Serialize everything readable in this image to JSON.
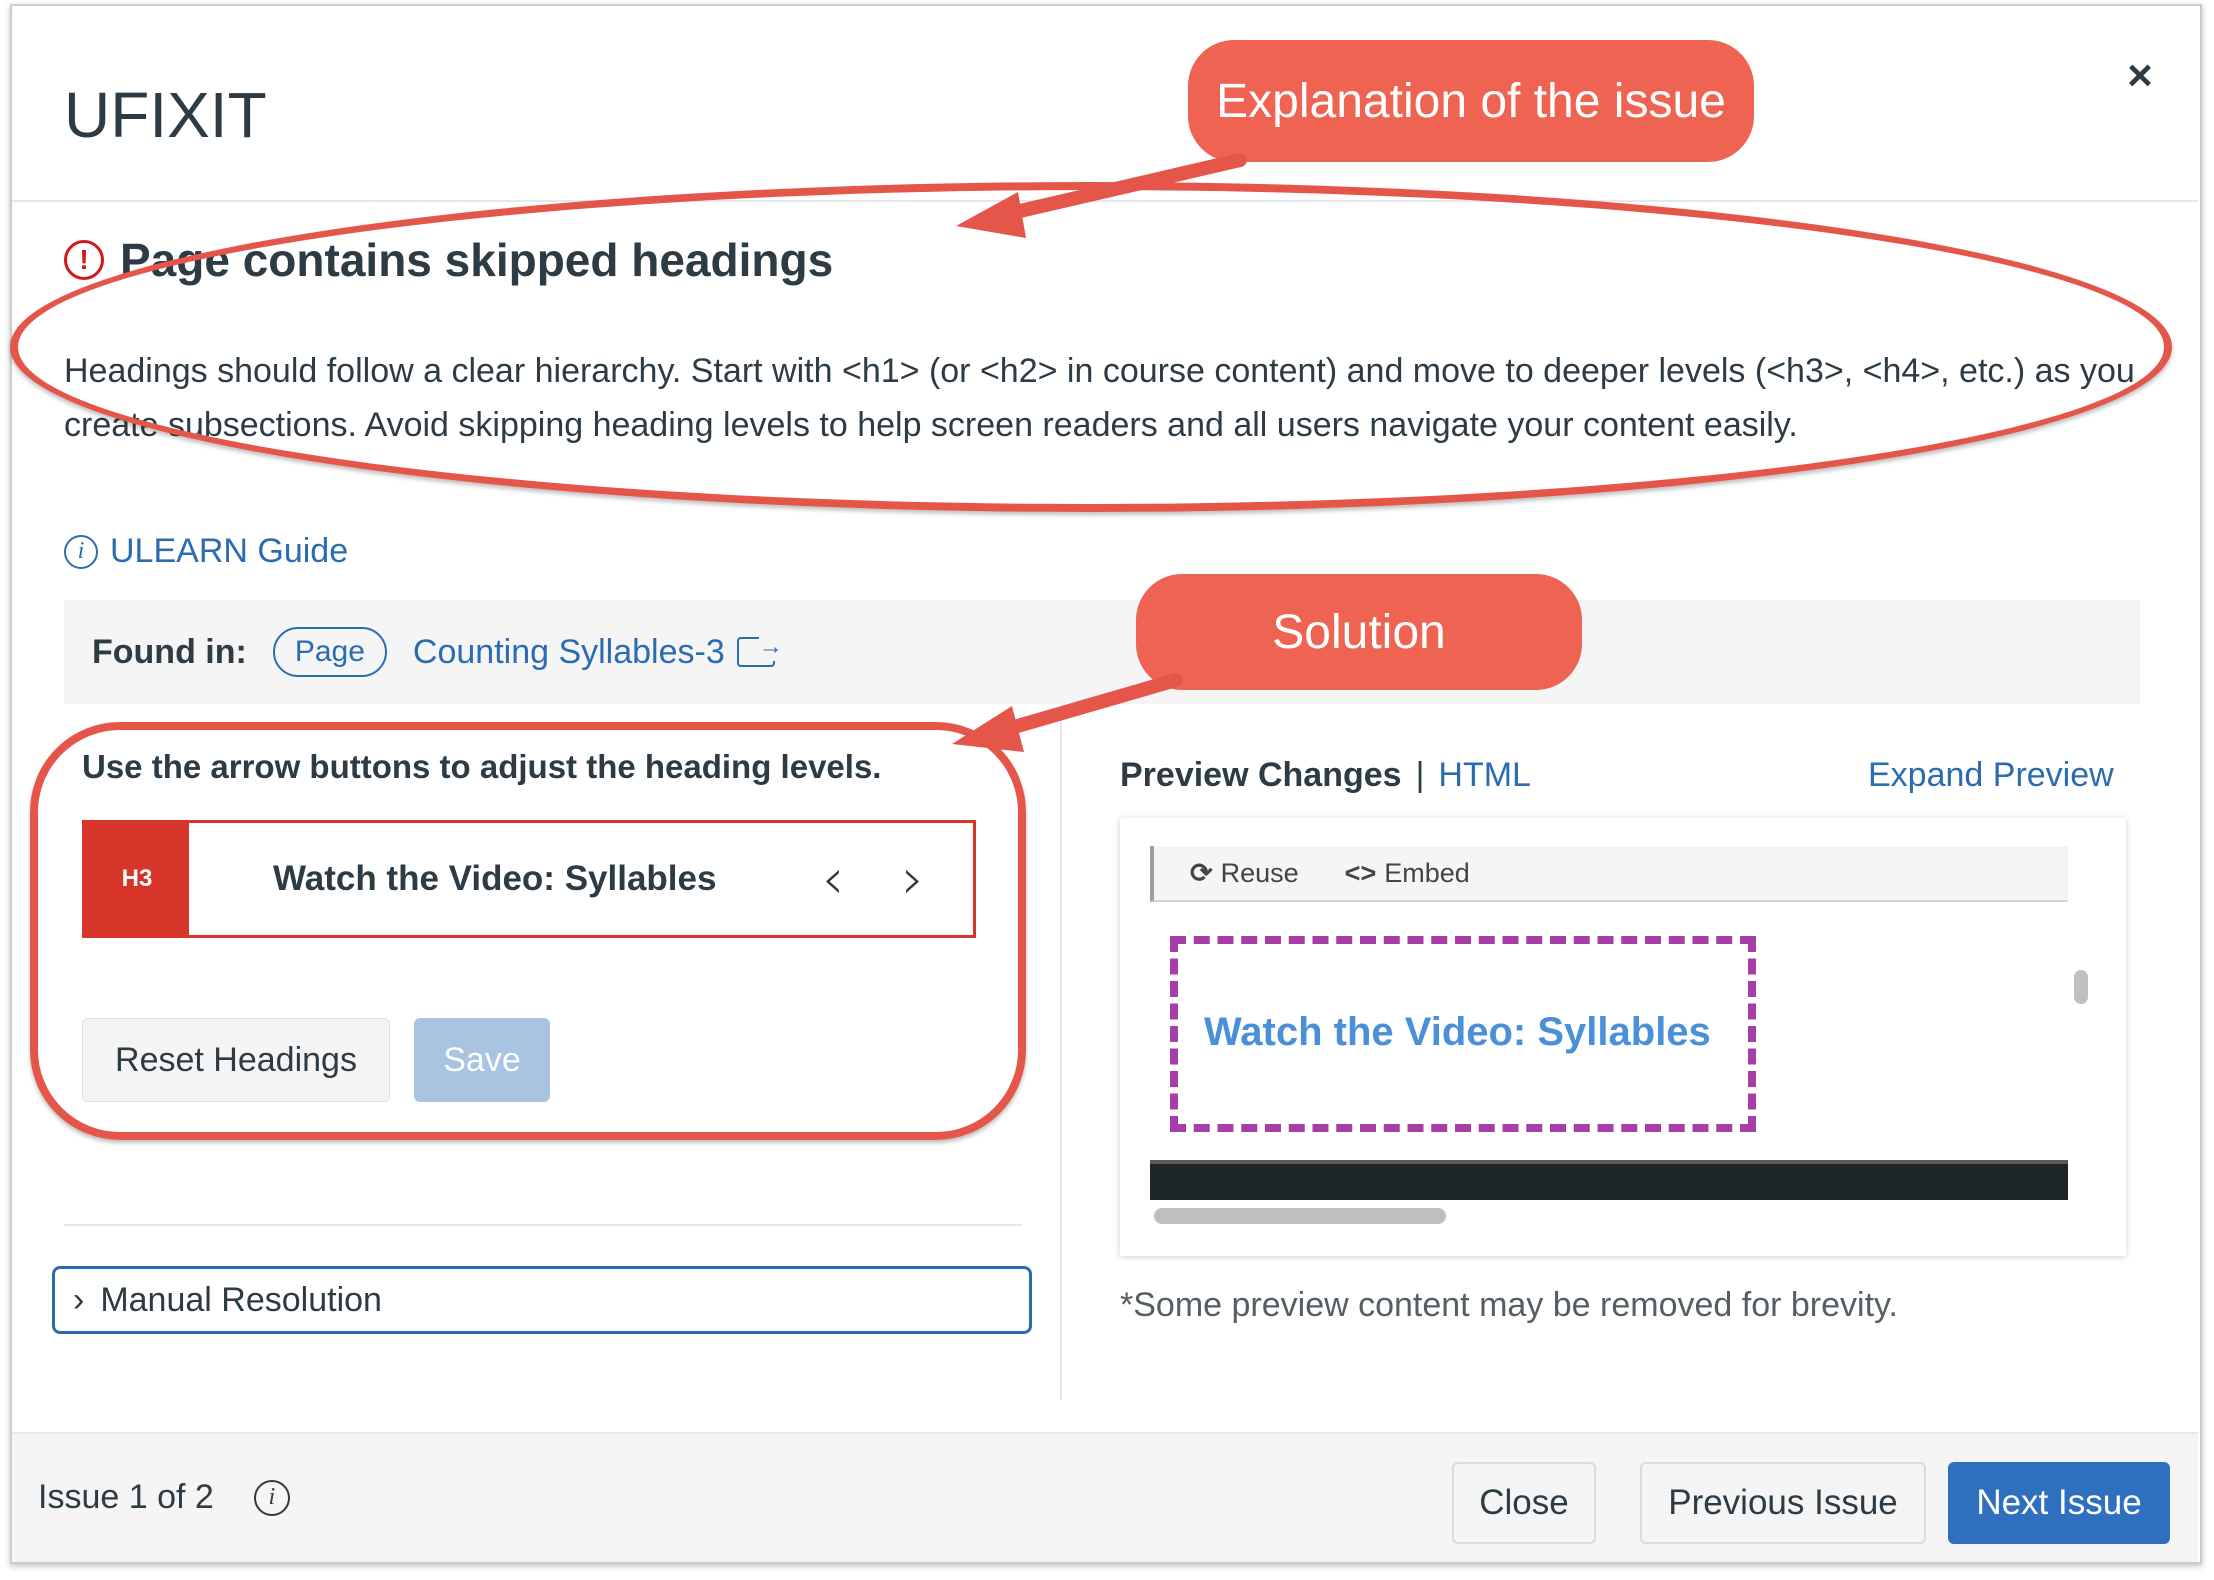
{
  "modal": {
    "app_title": "UFIXIT",
    "close_glyph": "×"
  },
  "issue": {
    "title": "Page contains skipped headings",
    "description": "Headings should follow a clear hierarchy. Start with <h1> (or <h2> in course content) and move to deeper levels (<h3>, <h4>, etc.) as you create subsections. Avoid skipping heading levels to help screen readers and all users navigate your content easily.",
    "guide_link": "ULEARN Guide"
  },
  "found_in": {
    "label": "Found in:",
    "type_pill": "Page",
    "link": "Counting Syllables-3"
  },
  "resolution": {
    "instruction": "Use the arrow buttons to adjust the heading levels.",
    "heading_badge": "H3",
    "heading_text": "Watch the Video: Syllables",
    "arrow_left": "‹",
    "arrow_right": "›",
    "reset_label": "Reset Headings",
    "save_label": "Save",
    "manual_label": "Manual Resolution"
  },
  "preview": {
    "title": "Preview Changes",
    "separator": "|",
    "html_tab": "HTML",
    "expand": "Expand Preview",
    "toolbar_reuse": "Reuse",
    "toolbar_embed": "Embed",
    "heading": "Watch the Video: Syllables",
    "note": "*Some preview content may be removed for brevity."
  },
  "footer": {
    "issue_count": "Issue 1 of 2",
    "close": "Close",
    "previous": "Previous Issue",
    "next": "Next Issue"
  },
  "annotations": {
    "callout_explanation": "Explanation of the issue",
    "callout_solution": "Solution"
  },
  "colors": {
    "accent": "#2b6cb0",
    "error": "#d8352a",
    "annotation": "#ee6352",
    "preview_outline": "#a73da6",
    "primary_button": "#2f6fbf"
  },
  "icons": [
    "close-icon",
    "warning-icon",
    "info-icon",
    "external-link-icon",
    "chevron-left-icon",
    "chevron-right-icon",
    "chevron-right-small-icon",
    "reuse-icon",
    "embed-icon"
  ]
}
